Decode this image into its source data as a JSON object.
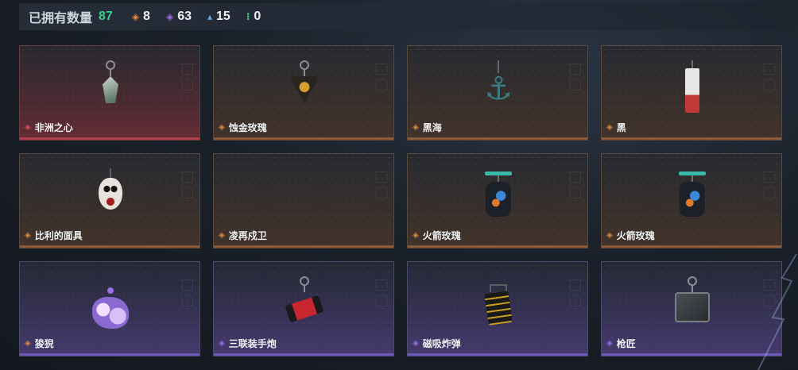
{
  "header": {
    "owned_label": "已拥有数量",
    "owned_count": "87",
    "stats": [
      {
        "icon": "orange-gem-icon",
        "color": "#e08a3a",
        "value": "8"
      },
      {
        "icon": "purple-gem-icon",
        "color": "#9b6ee8",
        "value": "63"
      },
      {
        "icon": "blue-gem-icon",
        "color": "#5aa8e8",
        "value": "15"
      },
      {
        "icon": "green-gem-icon",
        "color": "#46c98a",
        "value": "0"
      }
    ]
  },
  "items": [
    {
      "name": "非洲之心",
      "rarity": "red",
      "gem_color": "#e04a5a",
      "icon": "heart-gem-charm-icon"
    },
    {
      "name": "蚀金玫瑰",
      "rarity": "orange",
      "gem_color": "#e08a3a",
      "icon": "gold-rose-charm-icon"
    },
    {
      "name": "黑海",
      "rarity": "orange",
      "gem_color": "#e08a3a",
      "icon": "anchor-charm-icon"
    },
    {
      "name": "黑",
      "rarity": "orange",
      "gem_color": "#e08a3a",
      "icon": "card-charm-icon"
    },
    {
      "name": "比利的面具",
      "rarity": "orange",
      "gem_color": "#e08a3a",
      "icon": "mask-charm-icon"
    },
    {
      "name": "凌再戍卫",
      "rarity": "orange",
      "gem_color": "#e08a3a",
      "icon": "empty-charm-icon"
    },
    {
      "name": "火箭玫瑰",
      "rarity": "orange",
      "gem_color": "#e08a3a",
      "icon": "rocket-rose-charm-icon"
    },
    {
      "name": "火箭玫瑰",
      "rarity": "orange",
      "gem_color": "#e08a3a",
      "icon": "rocket-rose-charm-icon"
    },
    {
      "name": "狻猊",
      "rarity": "purple",
      "gem_color": "#9b6ee8",
      "icon": "lion-charm-icon"
    },
    {
      "name": "三联装手炮",
      "rarity": "purple",
      "gem_color": "#9b6ee8",
      "icon": "hand-cannon-charm-icon"
    },
    {
      "name": "磁吸炸弹",
      "rarity": "purple",
      "gem_color": "#9b6ee8",
      "icon": "magnet-bomb-charm-icon"
    },
    {
      "name": "枪匠",
      "rarity": "purple",
      "gem_color": "#9b6ee8",
      "icon": "gunsmith-tag-charm-icon"
    }
  ]
}
